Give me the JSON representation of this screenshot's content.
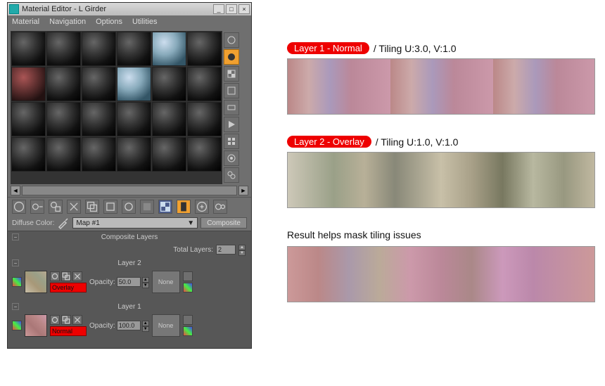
{
  "window": {
    "title": "Material Editor - L Girder",
    "menu": [
      "Material",
      "Navigation",
      "Options",
      "Utilities"
    ]
  },
  "diffuse": {
    "label": "Diffuse Color:",
    "map": "Map #1",
    "type_button": "Composite"
  },
  "composite": {
    "header": "Composite Layers",
    "total_label": "Total Layers:",
    "total_value": "2",
    "layers": [
      {
        "name": "Layer 2",
        "opacity_label": "Opacity:",
        "opacity": "50.0",
        "blend_mode": "Overlay",
        "mask": "None"
      },
      {
        "name": "Layer 1",
        "opacity_label": "Opacity:",
        "opacity": "100.0",
        "blend_mode": "Normal",
        "mask": "None"
      }
    ]
  },
  "annotations": {
    "layer1_pill": "Layer 1 - Normal",
    "layer1_tiling": "/ Tiling U:3.0, V:1.0",
    "layer2_pill": "Layer 2 - Overlay",
    "layer2_tiling": "/ Tiling U:1.0, V:1.0",
    "result": "Result helps mask tiling issues"
  }
}
